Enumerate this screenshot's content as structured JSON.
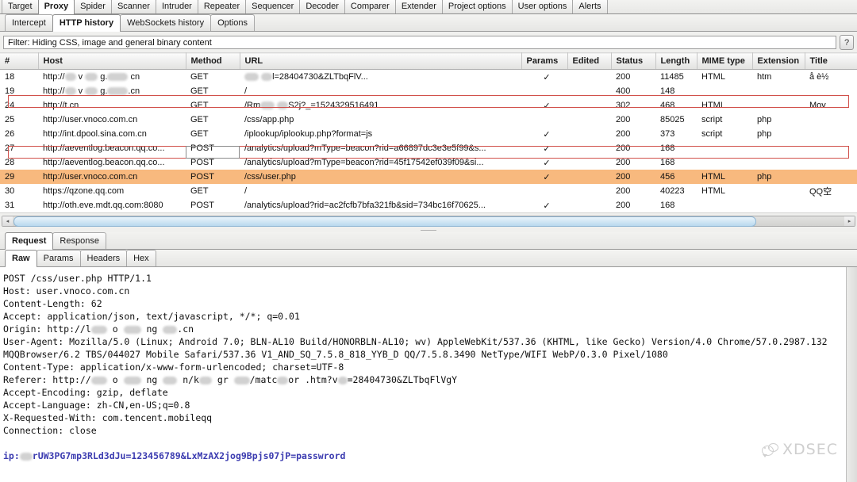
{
  "main_tabs": [
    {
      "label": "Target",
      "active": false
    },
    {
      "label": "Proxy",
      "active": true
    },
    {
      "label": "Spider",
      "active": false
    },
    {
      "label": "Scanner",
      "active": false
    },
    {
      "label": "Intruder",
      "active": false
    },
    {
      "label": "Repeater",
      "active": false
    },
    {
      "label": "Sequencer",
      "active": false
    },
    {
      "label": "Decoder",
      "active": false
    },
    {
      "label": "Comparer",
      "active": false
    },
    {
      "label": "Extender",
      "active": false
    },
    {
      "label": "Project options",
      "active": false
    },
    {
      "label": "User options",
      "active": false
    },
    {
      "label": "Alerts",
      "active": false
    }
  ],
  "sub_tabs": [
    {
      "label": "Intercept",
      "active": false
    },
    {
      "label": "HTTP history",
      "active": true
    },
    {
      "label": "WebSockets history",
      "active": false
    },
    {
      "label": "Options",
      "active": false
    }
  ],
  "filter": {
    "text": "Filter: Hiding CSS, image and general binary content",
    "help_label": "?"
  },
  "table": {
    "columns": [
      "#",
      "Host",
      "Method",
      "URL",
      "Params",
      "Edited",
      "Status",
      "Length",
      "MIME type",
      "Extension",
      "Title"
    ],
    "check_glyph": "✓",
    "rows": [
      {
        "num": "18",
        "host_pre": "http://",
        "host_post": "",
        "host_blurred": true,
        "method": "GET",
        "url": "",
        "url_post": "l=28404730&ZLTbqFlV...",
        "url_blurred": true,
        "params": "✓",
        "edited": "",
        "status": "200",
        "length": "11485",
        "mime": "HTML",
        "ext": "htm",
        "title": "å è½",
        "state": "normal"
      },
      {
        "num": "19",
        "host_pre": "http://",
        "host_post": ".cn",
        "host_blurred": true,
        "method": "GET",
        "url": "/",
        "url_post": "",
        "url_blurred": false,
        "params": "",
        "edited": "",
        "status": "400",
        "length": "148",
        "mime": "",
        "ext": "",
        "title": "",
        "state": "normal"
      },
      {
        "num": "24",
        "host_pre": "http://t.cn",
        "host_post": "",
        "host_blurred": false,
        "method": "GET",
        "url": "/Rm",
        "url_post": "S2j?_=1524329516491",
        "url_blurred": true,
        "params": "✓",
        "edited": "",
        "status": "302",
        "length": "468",
        "mime": "HTML",
        "ext": "",
        "title": "Mov",
        "state": "normal"
      },
      {
        "num": "25",
        "host_pre": "http://user.vnoco.com.cn",
        "host_post": "",
        "host_blurred": false,
        "method": "GET",
        "url": "/css/app.php",
        "url_post": "",
        "url_blurred": false,
        "params": "",
        "edited": "",
        "status": "200",
        "length": "85025",
        "mime": "script",
        "ext": "php",
        "title": "",
        "state": "outlined"
      },
      {
        "num": "26",
        "host_pre": "http://int.dpool.sina.com.cn",
        "host_post": "",
        "host_blurred": false,
        "method": "GET",
        "url": "/iplookup/iplookup.php?format=js",
        "url_post": "",
        "url_blurred": false,
        "params": "✓",
        "edited": "",
        "status": "200",
        "length": "373",
        "mime": "script",
        "ext": "php",
        "title": "",
        "state": "normal"
      },
      {
        "num": "27",
        "host_pre": "http://aeventlog.beacon.qq.co...",
        "host_post": "",
        "host_blurred": false,
        "method": "POST",
        "url": "/analytics/upload?mType=beacon?rid=a66897dc3e3e5f99&s...",
        "url_post": "",
        "url_blurred": false,
        "params": "✓",
        "edited": "",
        "status": "200",
        "length": "168",
        "mime": "",
        "ext": "",
        "title": "",
        "state": "normal"
      },
      {
        "num": "28",
        "host_pre": "http://aeventlog.beacon.qq.co...",
        "host_post": "",
        "host_blurred": false,
        "method": "POST",
        "url": "/analytics/upload?mType=beacon?rid=45f17542ef039f09&si...",
        "url_post": "",
        "url_blurred": false,
        "params": "✓",
        "edited": "",
        "status": "200",
        "length": "168",
        "mime": "",
        "ext": "",
        "title": "",
        "state": "normal"
      },
      {
        "num": "29",
        "host_pre": "http://user.vnoco.com.cn",
        "host_post": "",
        "host_blurred": false,
        "method": "POST",
        "url": "/css/user.php",
        "url_post": "",
        "url_blurred": false,
        "params": "✓",
        "edited": "",
        "status": "200",
        "length": "456",
        "mime": "HTML",
        "ext": "php",
        "title": "",
        "state": "selected"
      },
      {
        "num": "30",
        "host_pre": "https://qzone.qq.com",
        "host_post": "",
        "host_blurred": false,
        "method": "GET",
        "url": "/",
        "url_post": "",
        "url_blurred": false,
        "params": "",
        "edited": "",
        "status": "200",
        "length": "40223",
        "mime": "HTML",
        "ext": "",
        "title": "QQ空",
        "state": "normal"
      },
      {
        "num": "31",
        "host_pre": "http://oth.eve.mdt.qq.com:8080",
        "host_post": "",
        "host_blurred": false,
        "method": "POST",
        "url": "/analytics/upload?rid=ac2fcfb7bfa321fb&sid=734bc16f70625...",
        "url_post": "",
        "url_blurred": false,
        "params": "✓",
        "edited": "",
        "status": "200",
        "length": "168",
        "mime": "",
        "ext": "",
        "title": "",
        "state": "normal"
      }
    ]
  },
  "scrollbar": {
    "left_arrow": "◂",
    "right_arrow": "▸",
    "thumb_percent": 87
  },
  "message_tabs": [
    {
      "label": "Request",
      "active": true
    },
    {
      "label": "Response",
      "active": false
    }
  ],
  "view_tabs": [
    {
      "label": "Raw",
      "active": true
    },
    {
      "label": "Params",
      "active": false
    },
    {
      "label": "Headers",
      "active": false
    },
    {
      "label": "Hex",
      "active": false
    }
  ],
  "request": {
    "lines": [
      {
        "text": "POST /css/user.php HTTP/1.1"
      },
      {
        "text": "Host: user.vnoco.com.cn"
      },
      {
        "text": "Content-Length: 62"
      },
      {
        "text": "Accept: application/json, text/javascript, */*; q=0.01"
      },
      {
        "pre": "Origin: http://l",
        "post": ".cn",
        "blurred": true
      },
      {
        "text": "User-Agent: Mozilla/5.0 (Linux; Android 7.0; BLN-AL10 Build/HONORBLN-AL10; wv) AppleWebKit/537.36 (KHTML, like Gecko) Version/4.0 Chrome/57.0.2987.132"
      },
      {
        "text": "MQQBrowser/6.2 TBS/044027 Mobile Safari/537.36 V1_AND_SQ_7.5.8_818_YYB_D QQ/7.5.8.3490 NetType/WIFI WebP/0.3.0 Pixel/1080"
      },
      {
        "text": "Content-Type: application/x-www-form-urlencoded; charset=UTF-8"
      },
      {
        "pre": "Referer: http://",
        "post": ".htm?v",
        "post2": "=28404730&ZLTbqFlVgY",
        "blurred": true
      },
      {
        "text": "Accept-Encoding: gzip, deflate"
      },
      {
        "text": "Accept-Language: zh-CN,en-US;q=0.8"
      },
      {
        "text": "X-Requested-With: com.tencent.mobileqq"
      },
      {
        "text": "Connection: close"
      },
      {
        "text": ""
      }
    ],
    "body": {
      "prefix": "ip:",
      "value": "rUW3PG7mp3RLd3dJu=123456789&LxMzAX2jog9Bpjs07jP=passwrord",
      "color": "#3b3bb0"
    }
  },
  "watermark": {
    "text": "XDSEC"
  }
}
